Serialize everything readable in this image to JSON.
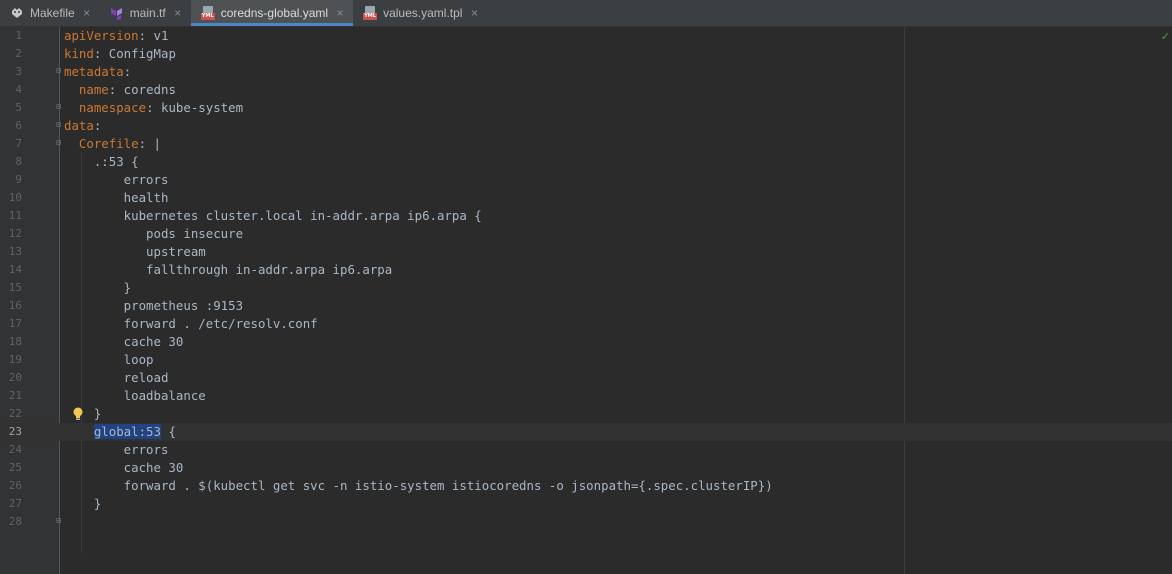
{
  "tabs": [
    {
      "label": "Makefile",
      "icon": "makefile-icon",
      "active": false,
      "close": "×"
    },
    {
      "label": "main.tf",
      "icon": "terraform-icon",
      "active": false,
      "close": "×"
    },
    {
      "label": "coredns-global.yaml",
      "icon": "yaml-file-icon",
      "active": true,
      "close": "×"
    },
    {
      "label": "values.yaml.tpl",
      "icon": "yaml-file-icon",
      "active": false,
      "close": "×"
    }
  ],
  "editor": {
    "current_line": 23,
    "inspection_status": "✓",
    "lines": [
      {
        "n": "1",
        "key": "apiVersion",
        "rest": ": v1",
        "indent": ""
      },
      {
        "n": "2",
        "key": "kind",
        "rest": ": ConfigMap",
        "indent": ""
      },
      {
        "n": "3",
        "key": "metadata",
        "rest": ":",
        "indent": ""
      },
      {
        "n": "4",
        "key": "name",
        "rest": ": coredns",
        "indent": "  "
      },
      {
        "n": "5",
        "key": "namespace",
        "rest": ": kube-system",
        "indent": "  "
      },
      {
        "n": "6",
        "key": "data",
        "rest": ":",
        "indent": ""
      },
      {
        "n": "7",
        "key": "Corefile",
        "rest": ": |",
        "indent": "  "
      },
      {
        "n": "8",
        "text": "    .:53 {"
      },
      {
        "n": "9",
        "text": "        errors"
      },
      {
        "n": "10",
        "text": "        health"
      },
      {
        "n": "11",
        "text": "        kubernetes cluster.local in-addr.arpa ip6.arpa {"
      },
      {
        "n": "12",
        "text": "           pods insecure"
      },
      {
        "n": "13",
        "text": "           upstream"
      },
      {
        "n": "14",
        "text": "           fallthrough in-addr.arpa ip6.arpa"
      },
      {
        "n": "15",
        "text": "        }"
      },
      {
        "n": "16",
        "text": "        prometheus :9153"
      },
      {
        "n": "17",
        "text": "        forward . /etc/resolv.conf"
      },
      {
        "n": "18",
        "text": "        cache 30"
      },
      {
        "n": "19",
        "text": "        loop"
      },
      {
        "n": "20",
        "text": "        reload"
      },
      {
        "n": "21",
        "text": "        loadbalance"
      },
      {
        "n": "22",
        "text": "    }"
      },
      {
        "n": "23",
        "pre": "    ",
        "selected": "global:53",
        "post": " {"
      },
      {
        "n": "24",
        "text": "        errors"
      },
      {
        "n": "25",
        "text": "        cache 30"
      },
      {
        "n": "26",
        "text": "        forward . $(kubectl get svc -n istio-system istiocoredns -o jsonpath={.spec.clusterIP})"
      },
      {
        "n": "27",
        "text": "    }"
      },
      {
        "n": "28",
        "text": ""
      }
    ],
    "fold_markers": {
      "3": "⊟",
      "5": "⊟",
      "6": "⊟",
      "7": "⊟",
      "28": "⊟"
    },
    "bulb_line": "22"
  },
  "colors": {
    "keyword": "#cc7832",
    "text": "#a9b7c6",
    "selection": "#214283",
    "tab_underline": "#4a88c7"
  }
}
